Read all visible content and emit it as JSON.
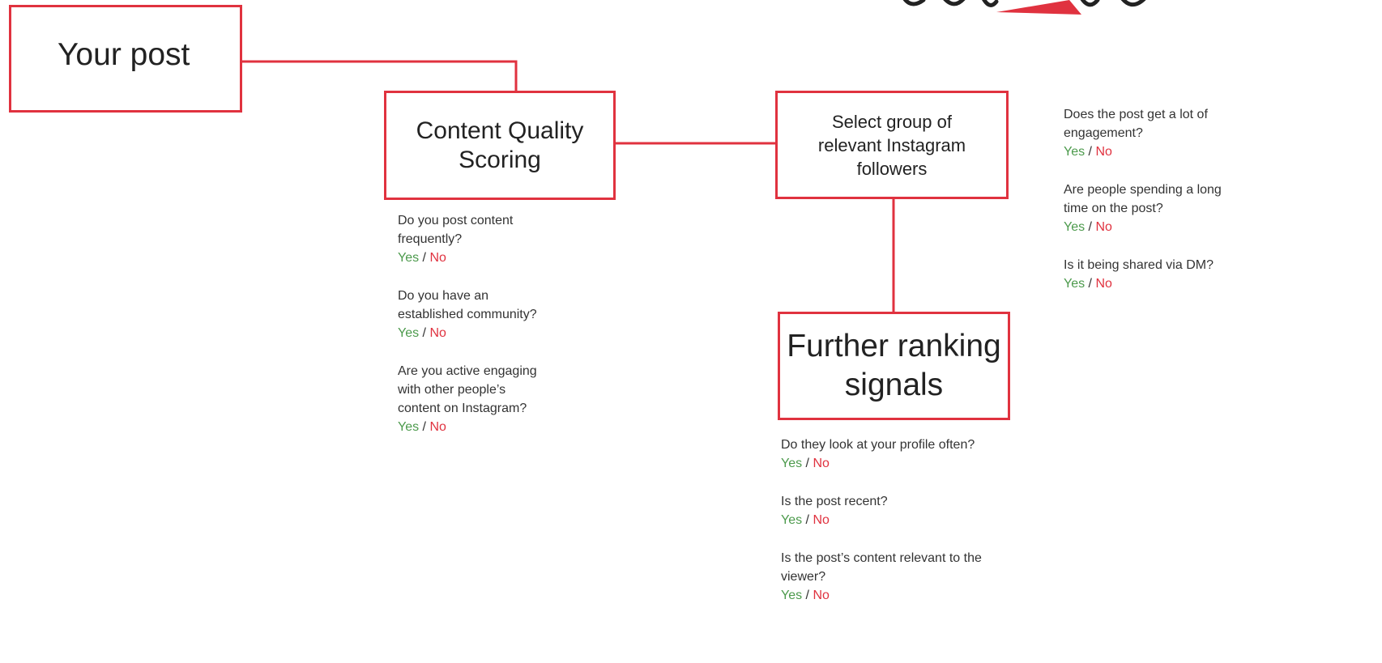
{
  "nodes": {
    "your_post": "Your post",
    "content_quality": "Content Quality\nScoring",
    "select_group": "Select group of\nrelevant Instagram\nfollowers",
    "further_ranking": "Further ranking\nsignals"
  },
  "question_groups": {
    "content_quality": [
      {
        "text": "Do you post content\nfrequently?",
        "yes": "Yes",
        "sep": " / ",
        "no": "No"
      },
      {
        "text": "Do you have an\nestablished community?",
        "yes": "Yes",
        "sep": " / ",
        "no": "No"
      },
      {
        "text": "Are you active engaging\nwith other people’s\ncontent on Instagram?",
        "yes": "Yes",
        "sep": " / ",
        "no": "No"
      }
    ],
    "further_ranking": [
      {
        "text": "Do they look at your profile often?",
        "yes": "Yes",
        "sep": " / ",
        "no": "No"
      },
      {
        "text": "Is the post recent?",
        "yes": "Yes",
        "sep": " / ",
        "no": "No"
      },
      {
        "text": "Is the post’s content relevant to the\nviewer?",
        "yes": "Yes",
        "sep": " / ",
        "no": "No"
      }
    ],
    "select_group": [
      {
        "text": "Does the post get a lot of\nengagement?",
        "yes": "Yes",
        "sep": " / ",
        "no": "No"
      },
      {
        "text": "Are people spending a long\ntime on the post?",
        "yes": "Yes",
        "sep": " / ",
        "no": "No"
      },
      {
        "text": "Is it being shared via DM?",
        "yes": "Yes",
        "sep": " / ",
        "no": "No"
      }
    ]
  },
  "colors": {
    "accent": "#e0323f",
    "yes": "#4c9a4c",
    "no": "#e0323f",
    "text": "#333333"
  }
}
